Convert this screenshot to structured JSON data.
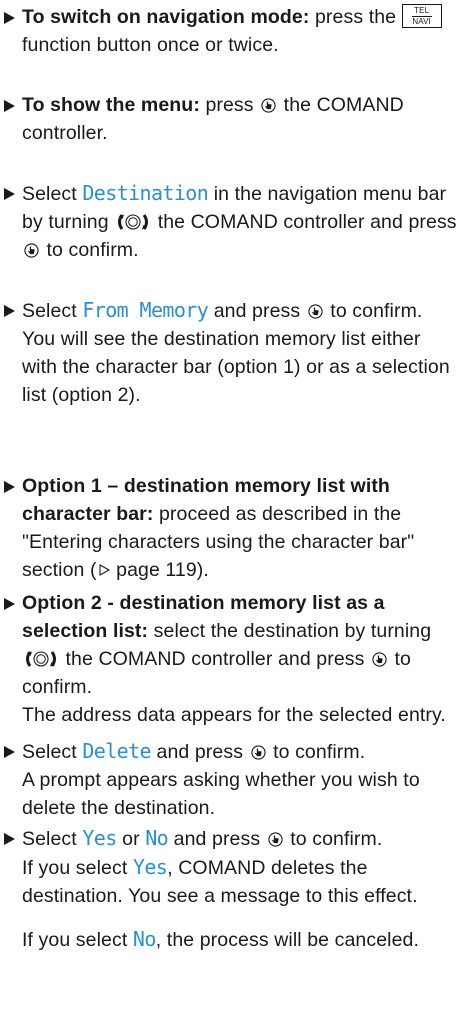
{
  "accent_color": "#2a8fd6",
  "icons": {
    "press": "controller-press-icon",
    "turn": "controller-turn-icon",
    "tel_navi_button": "tel-navi-button-icon",
    "page_ref": "page-reference-triangle-icon"
  },
  "tel_navi": {
    "top": "TEL",
    "bottom": "NAVI"
  },
  "steps": [
    {
      "bold": "To switch on navigation mode:",
      "t1": " press the",
      "t2": " function button once or twice."
    },
    {
      "bold": "To show the menu:",
      "t1": " press",
      "t2": " the COMAND controller."
    },
    {
      "t1": "Select ",
      "code": "Destination",
      "t2": " in the navigation menu bar by turning",
      "t3": " the COMAND controller and press",
      "t4": " to confirm."
    },
    {
      "t1": "Select ",
      "code": "From Memory",
      "t2": " and press",
      "t3": " to confirm.",
      "p": "You will see the destination memory list either with the character bar (option 1) or as a selection list (option 2)."
    },
    {
      "bold": "Option 1 – destination memory list with character bar:",
      "t1": " proceed as described in the \"Entering characters using the character bar\" section (",
      "t2": " page 119)."
    },
    {
      "bold": "Option 2 - destination memory list as a selection list:",
      "t1": " select the destination by turning",
      "t2": " the COMAND controller and press",
      "t3": " to confirm.",
      "p": "The address data appears for the selected entry."
    },
    {
      "t1": "Select ",
      "code": "Delete",
      "t2": " and press",
      "t3": " to confirm.",
      "p": "A prompt appears asking whether you wish to delete the destination."
    },
    {
      "t1": "Select ",
      "code": "Yes",
      "t2": " or ",
      "code2": "No",
      "t3": " and press",
      "t4": " to confirm.",
      "p1a": "If you select ",
      "p1code": "Yes",
      "p1b": ", COMAND deletes the destination. You see a message to this effect.",
      "p2a": "If you select ",
      "p2code": "No",
      "p2b": ", the process will be canceled."
    }
  ]
}
